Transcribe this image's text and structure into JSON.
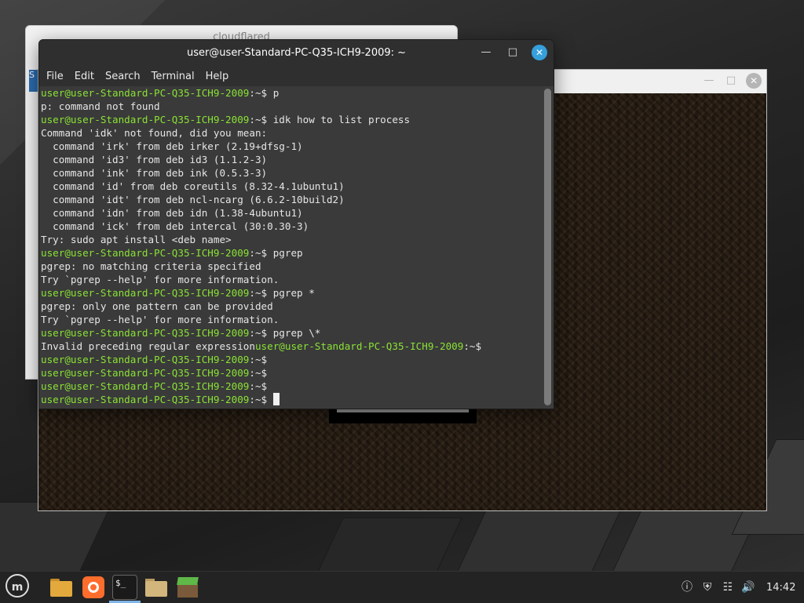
{
  "back_window": {
    "title": "cloudflared",
    "side_label": "S"
  },
  "terminal": {
    "title": "user@user-Standard-PC-Q35-ICH9-2009: ~",
    "menu": [
      "File",
      "Edit",
      "Search",
      "Terminal",
      "Help"
    ],
    "prompt": "user@user-Standard-PC-Q35-ICH9-2009",
    "prompt_suffix": ":~$",
    "lines": [
      {
        "type": "prompt",
        "cmd": " p"
      },
      {
        "type": "out",
        "text": "p: command not found"
      },
      {
        "type": "prompt",
        "cmd": " idk how to list process"
      },
      {
        "type": "out",
        "text": "Command 'idk' not found, did you mean:"
      },
      {
        "type": "out",
        "text": "  command 'irk' from deb irker (2.19+dfsg-1)"
      },
      {
        "type": "out",
        "text": "  command 'id3' from deb id3 (1.1.2-3)"
      },
      {
        "type": "out",
        "text": "  command 'ink' from deb ink (0.5.3-3)"
      },
      {
        "type": "out",
        "text": "  command 'id' from deb coreutils (8.32-4.1ubuntu1)"
      },
      {
        "type": "out",
        "text": "  command 'idt' from deb ncl-ncarg (6.6.2-10build2)"
      },
      {
        "type": "out",
        "text": "  command 'idn' from deb idn (1.38-4ubuntu1)"
      },
      {
        "type": "out",
        "text": "  command 'ick' from deb intercal (30:0.30-3)"
      },
      {
        "type": "out",
        "text": "Try: sudo apt install <deb name>"
      },
      {
        "type": "prompt",
        "cmd": " pgrep"
      },
      {
        "type": "out",
        "text": "pgrep: no matching criteria specified"
      },
      {
        "type": "out",
        "text": "Try `pgrep --help' for more information."
      },
      {
        "type": "prompt",
        "cmd": " pgrep *"
      },
      {
        "type": "out",
        "text": "pgrep: only one pattern can be provided"
      },
      {
        "type": "out",
        "text": "Try `pgrep --help' for more information."
      },
      {
        "type": "prompt",
        "cmd": " pgrep \\*"
      },
      {
        "type": "mixed",
        "text": "Invalid preceding regular expression",
        "cmd": ""
      },
      {
        "type": "prompt",
        "cmd": ""
      },
      {
        "type": "prompt",
        "cmd": ""
      },
      {
        "type": "prompt",
        "cmd": ""
      },
      {
        "type": "prompt",
        "cmd": " ",
        "cursor": true
      }
    ]
  },
  "taskbar": {
    "apps": [
      "mint-menu-icon",
      "files-icon",
      "firefox-icon",
      "terminal-icon",
      "file-manager-icon",
      "minecraft-icon"
    ],
    "terminal_icon_text": "$_",
    "mint_label": "m",
    "clock": "14:42"
  }
}
